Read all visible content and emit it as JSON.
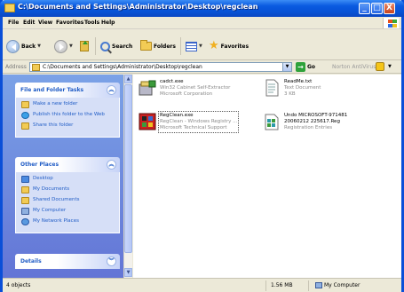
{
  "window": {
    "title": "C:\\Documents and Settings\\Administrator\\Desktop\\regclean",
    "min_label": "_",
    "max_label": "□",
    "close_label": "X"
  },
  "menu": [
    "File",
    "Edit",
    "View",
    "Favorites",
    "Tools",
    "Help"
  ],
  "toolbar": {
    "back_label": "Back",
    "search_label": "Search",
    "folders_label": "Folders",
    "favorites_label": "Favorites"
  },
  "address": {
    "label": "Address",
    "value": "C:\\Documents and Settings\\Administrator\\Desktop\\regclean",
    "go_label": "Go",
    "norton_label": "Norton AntiVirus"
  },
  "sidebar": {
    "file_tasks": {
      "title": "File and Folder Tasks",
      "items": [
        {
          "label": "Make a new folder"
        },
        {
          "label": "Publish this folder to the Web"
        },
        {
          "label": "Share this folder"
        }
      ]
    },
    "other_places": {
      "title": "Other Places",
      "items": [
        {
          "label": "Desktop"
        },
        {
          "label": "My Documents"
        },
        {
          "label": "Shared Documents"
        },
        {
          "label": "My Computer"
        },
        {
          "label": "My Network Places"
        }
      ]
    },
    "details": {
      "title": "Details"
    }
  },
  "files": [
    {
      "name": "cadct.exe",
      "line2": "Win32 Cabinet Self-Extractor",
      "line3": "Microsoft Corporation"
    },
    {
      "name": "ReadMe.txt",
      "line2": "Text Document",
      "line3": "3 KB"
    },
    {
      "name": "RegClean.exe",
      "line2": "RegClean - Windows Registry ...",
      "line3": "Microsoft Technical Support"
    },
    {
      "name": "Undo MICROSOFT-971481",
      "line2": "20060212 225617.Reg",
      "line3": "Registration Entries"
    }
  ],
  "status": {
    "objects": "4 objects",
    "size": "1.56 MB",
    "location": "My Computer"
  },
  "colors": {
    "title_bar": "#0a5ae0",
    "task_pane": "#6f8ee0",
    "link": "#215dc6"
  }
}
